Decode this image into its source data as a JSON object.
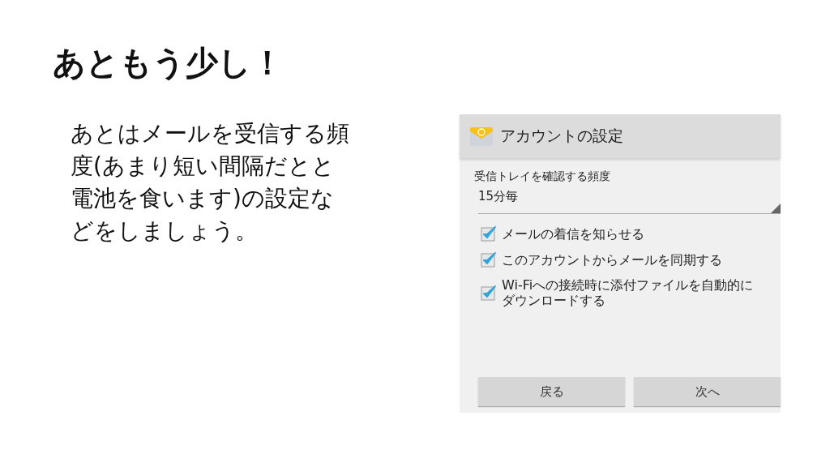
{
  "slide": {
    "title": "あともう少し！",
    "body": "あとはメールを受信する頻度(あまり短い間隔だとと電池を食います)の設定などをしましょう。"
  },
  "screen": {
    "title": "アカウントの設定",
    "frequency": {
      "label": "受信トレイを確認する頻度",
      "value": "15分毎"
    },
    "options": [
      {
        "label": "メールの着信を知らせる",
        "checked": true
      },
      {
        "label": "このアカウントからメールを同期する",
        "checked": true
      },
      {
        "label": "Wi-Fiへの接続時に添付ファイルを自動的にダウンロードする",
        "checked": true
      }
    ],
    "buttons": [
      "戻る",
      "次へ"
    ]
  }
}
